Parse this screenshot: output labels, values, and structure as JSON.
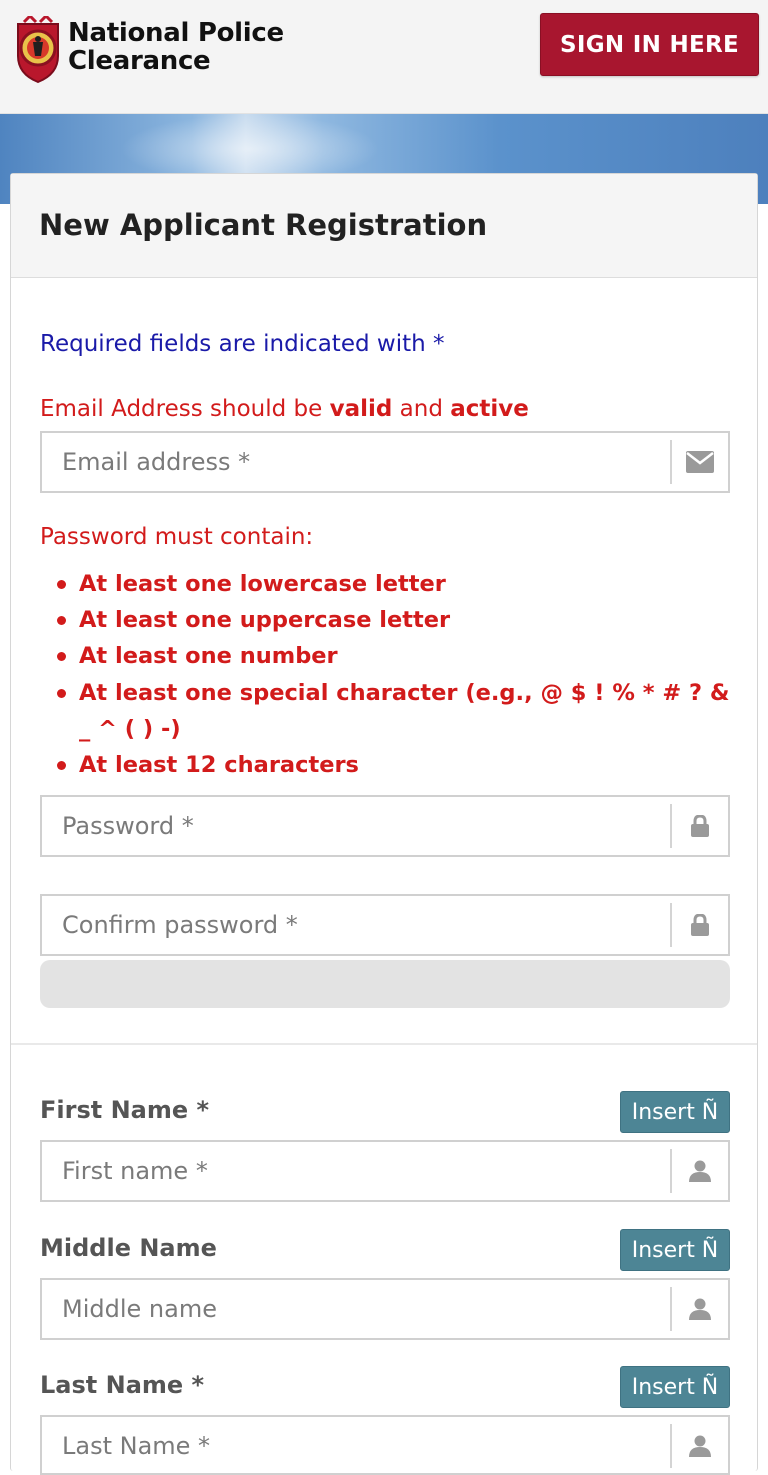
{
  "header": {
    "brand_line1": "National Police",
    "brand_line2": "Clearance",
    "signin_label": "SIGN IN HERE"
  },
  "form": {
    "title": "New Applicant Registration",
    "required_note": "Required fields are indicated with *",
    "email_note": {
      "part1": "Email Address should be ",
      "bold1": "valid",
      "part2": " and ",
      "bold2": "active"
    },
    "email_placeholder": "Email address *",
    "password_title": "Password must contain:",
    "password_rules": [
      "At least one lowercase letter",
      "At least one uppercase letter",
      "At least one number",
      "At least one special character (e.g., @ $ ! % * # ? & _ ^ ( ) -)",
      "At least 12 characters"
    ],
    "password_placeholder": "Password *",
    "confirm_placeholder": "Confirm password *",
    "first_name_label": "First Name *",
    "first_name_placeholder": "First name *",
    "middle_name_label": "Middle Name",
    "middle_name_placeholder": "Middle name",
    "last_name_label": "Last Name *",
    "last_name_placeholder": "Last Name *",
    "insert_label": "Insert Ñ"
  },
  "colors": {
    "brand_red": "#a8162f",
    "warning_red": "#d21b1b",
    "note_blue": "#1a1aa8",
    "insert_teal": "#4d8595"
  }
}
